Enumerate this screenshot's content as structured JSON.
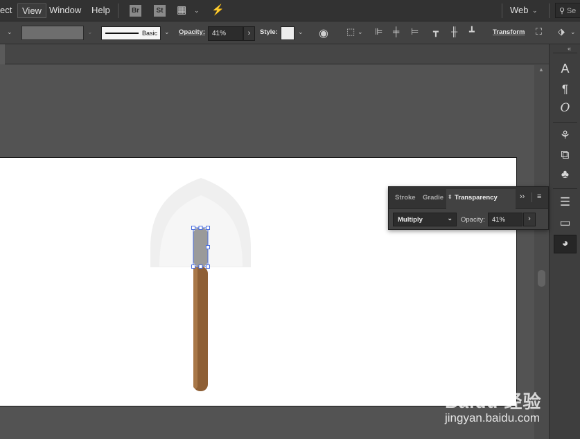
{
  "menubar": {
    "items": [
      "ect",
      "View",
      "Window",
      "Help"
    ],
    "bridge_badge": "Br",
    "stock_badge": "St",
    "workspace": "Web",
    "search_placeholder": "Se"
  },
  "controlbar": {
    "stroke_profile": "Basic",
    "opacity_label": "Opacity:",
    "opacity_value": "41%",
    "style_label": "Style:",
    "transform_label": "Transform"
  },
  "panel": {
    "tabs": [
      "Stroke",
      "Gradie",
      "Transparency"
    ],
    "blend_mode": "Multiply",
    "opacity_label": "Opacity:",
    "opacity_value": "41%"
  },
  "watermark": {
    "logo_text": "Baidu 经验",
    "url": "jingyan.baidu.com"
  },
  "icons": {
    "character": "character-icon",
    "paragraph": "paragraph-icon",
    "opentype": "opentype-icon",
    "symbols": "symbols-icon",
    "transparency": "transparency-icon"
  },
  "colors": {
    "handle": "#8e5f35",
    "selection": "#4a6ee0",
    "shovel_blade": "#efefef"
  }
}
